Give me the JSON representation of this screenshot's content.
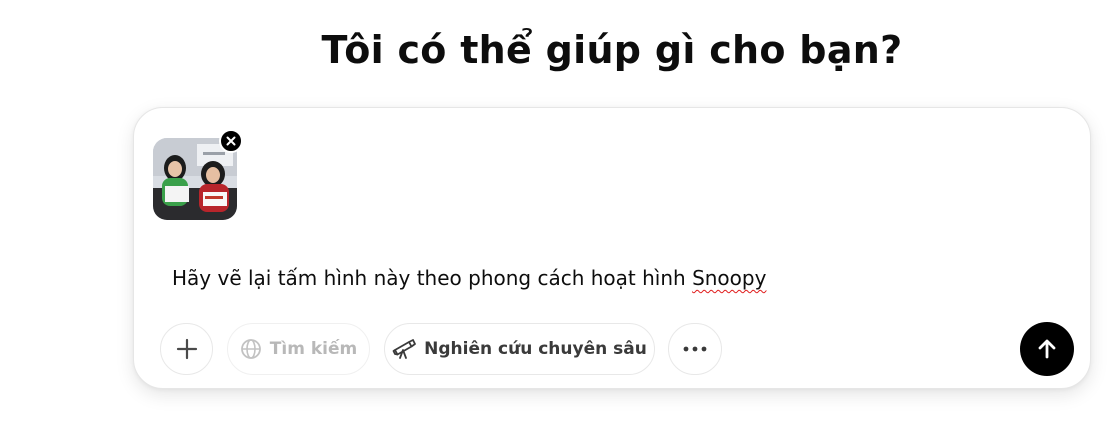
{
  "heading": "Tôi có thể giúp gì cho bạn?",
  "composer": {
    "prompt_before": "Hãy vẽ lại tấm hình này theo phong cách hoạt hình ",
    "prompt_misspelled": "Snoopy",
    "attachment_icon": "image-thumbnail",
    "remove_icon": "close-icon"
  },
  "toolbar": {
    "add_icon": "plus-icon",
    "search_label": "Tìm kiếm",
    "search_icon": "globe-icon",
    "research_label": "Nghiên cứu chuyên sâu",
    "research_icon": "telescope-icon",
    "more_icon": "more-horizontal-icon",
    "send_icon": "arrow-up-icon"
  },
  "colors": {
    "send_button": "#000000",
    "disabled_text": "#b8b8b8",
    "spellcheck_underline": "#e01b1b"
  }
}
